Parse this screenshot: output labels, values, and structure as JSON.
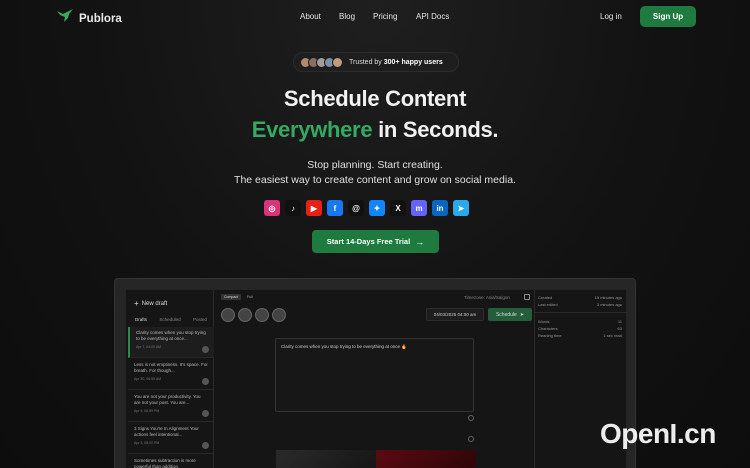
{
  "nav": {
    "brand": "Publora",
    "links": [
      "About",
      "Blog",
      "Pricing",
      "API Docs"
    ],
    "login": "Log in",
    "signup": "Sign Up"
  },
  "trusted": {
    "prefix": "Trusted by ",
    "count": "300+ happy users"
  },
  "hero": {
    "line1": "Schedule Content",
    "highlight": "Everywhere",
    "line2_rest": " in Seconds.",
    "sub1": "Stop planning. Start creating.",
    "sub2": "The easiest way to create content and grow on social media.",
    "cta": "Start 14-Days Free Trial",
    "cta_icon": "→"
  },
  "socials": [
    {
      "icon": "instagram-icon",
      "glyph": "◎",
      "color": "#d9347a"
    },
    {
      "icon": "tiktok-icon",
      "glyph": "♪",
      "color": "#111111"
    },
    {
      "icon": "youtube-icon",
      "glyph": "▶",
      "color": "#e62117"
    },
    {
      "icon": "facebook-icon",
      "glyph": "f",
      "color": "#1877f2"
    },
    {
      "icon": "threads-icon",
      "glyph": "@",
      "color": "#111111"
    },
    {
      "icon": "bluesky-icon",
      "glyph": "✦",
      "color": "#1185fe"
    },
    {
      "icon": "x-icon",
      "glyph": "X",
      "color": "#111111"
    },
    {
      "icon": "mastodon-icon",
      "glyph": "m",
      "color": "#6364ff"
    },
    {
      "icon": "linkedin-icon",
      "glyph": "in",
      "color": "#0a66c2"
    },
    {
      "icon": "telegram-icon",
      "glyph": "➤",
      "color": "#29a9eb"
    }
  ],
  "app": {
    "new_draft": "New draft",
    "tabs": [
      "Drafts",
      "Scheduled",
      "Posted"
    ],
    "modes": [
      "Compact",
      "Full"
    ],
    "timezone": "Timezone: Asia/Saigon",
    "datetime": "04/03/2025 04:00 am",
    "schedule": "Schedule",
    "editor_text": "Clarity comes when you stop trying to be everything at once 🔥",
    "drafts": [
      {
        "text": "Clarity comes when you stop trying to be everything at once...",
        "date": "Apr 7, 04:00 AM"
      },
      {
        "text": "Less is not emptiness. It's space. For breath. For though...",
        "date": "Apr 30, 06:59 AM"
      },
      {
        "text": "You are not your productivity. You are not your post. You are...",
        "date": "Apr 4, 06:59 PM"
      },
      {
        "text": "3 Signs You're In Alignment Your actions feel intentional...",
        "date": "Apr 3, 08:00 PM"
      },
      {
        "text": "Sometimes subtraction is more powerful than addition.",
        "date": ""
      }
    ],
    "meta": [
      {
        "label": "Created",
        "value": "15 minutes ago"
      },
      {
        "label": "Last edited",
        "value": "3 minutes ago"
      },
      {
        "label": "Words",
        "value": "11"
      },
      {
        "label": "Characters",
        "value": "63"
      },
      {
        "label": "Reading time",
        "value": "1 sec read"
      }
    ]
  },
  "watermark": "OpenI.cn",
  "colors": {
    "accent": "#1f7a3f",
    "highlight": "#35a862",
    "bg": "#121212"
  }
}
